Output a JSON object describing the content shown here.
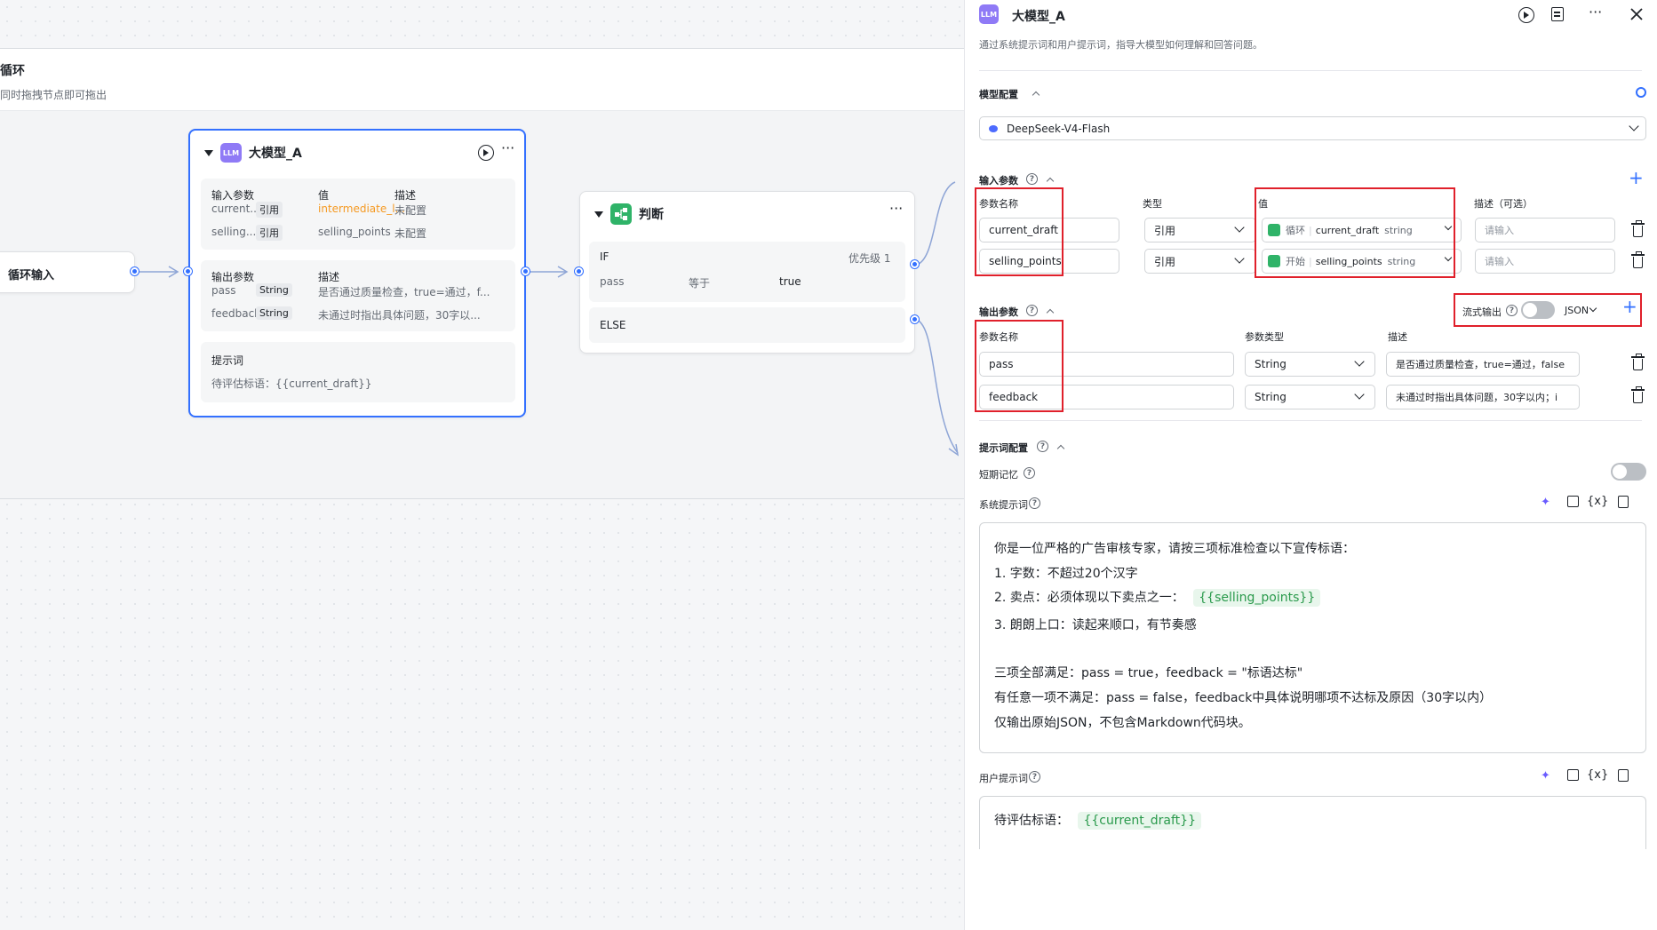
{
  "canvas": {
    "loop_title": "循环",
    "loop_hint": "同时拖拽节点即可拖出",
    "loop_input_node": "循环输入",
    "llm_node": {
      "title": "大模型_A",
      "inputs_header": {
        "name": "输入参数",
        "value": "值",
        "desc": "描述"
      },
      "inputs": [
        {
          "name": "current...",
          "type": "引用",
          "value": "intermediate_l...",
          "desc": "未配置"
        },
        {
          "name": "selling...",
          "type": "引用",
          "value": "selling_points",
          "desc": "未配置"
        }
      ],
      "outputs_header": {
        "name": "输出参数",
        "desc": "描述"
      },
      "outputs": [
        {
          "name": "pass",
          "type": "String",
          "desc": "是否通过质量检查，true=通过，f..."
        },
        {
          "name": "feedback",
          "type": "String",
          "desc": "未通过时指出具体问题，30字以..."
        }
      ],
      "prompt_label": "提示词",
      "prompt_text": "待评估标语：{{current_draft}}"
    },
    "condition_node": {
      "title": "判断",
      "if_label": "IF",
      "priority": "优先级 1",
      "cond_left": "pass",
      "cond_op": "等于",
      "cond_right": "true",
      "else_label": "ELSE"
    }
  },
  "panel": {
    "title": "大模型_A",
    "badge": "LLM",
    "description": "通过系统提示词和用户提示词，指导大模型如何理解和回答问题。",
    "model_section": "模型配置",
    "model_name": "DeepSeek-V4-Flash",
    "input_section": "输入参数",
    "input_cols": {
      "name": "参数名称",
      "type": "类型",
      "value": "值",
      "desc": "描述（可选）"
    },
    "inputs": [
      {
        "name": "current_draft",
        "type": "引用",
        "source": "循环",
        "var": "current_draft",
        "vtype": "string",
        "desc_placeholder": "请输入"
      },
      {
        "name": "selling_points",
        "type": "引用",
        "source": "开始",
        "var": "selling_points",
        "vtype": "string",
        "desc_placeholder": "请输入"
      }
    ],
    "output_section": "输出参数",
    "stream_label": "流式输出",
    "output_format": "JSON",
    "output_cols": {
      "name": "参数名称",
      "type": "参数类型",
      "desc": "描述"
    },
    "outputs": [
      {
        "name": "pass",
        "type": "String",
        "desc": "是否通过质量检查，true=通过，false"
      },
      {
        "name": "feedback",
        "type": "String",
        "desc": "未通过时指出具体问题，30字以内；i"
      }
    ],
    "prompt_section": "提示词配置",
    "short_memory": "短期记忆",
    "system_prompt_label": "系统提示词",
    "system_prompt": {
      "line1": "你是一位严格的广告审核专家，请按三项标准检查以下宣传标语：",
      "line2": "1. 字数：不超过20个汉字",
      "line3_prefix": "2. 卖点：必须体现以下卖点之一：",
      "line3_var": "{{selling_points}}",
      "line4": "3. 朗朗上口：读起来顺口，有节奏感",
      "line5": "三项全部满足：pass = true，feedback = \"标语达标\"",
      "line6": "有任意一项不满足：pass = false，feedback中具体说明哪项不达标及原因（30字以内）",
      "line7": "仅输出原始JSON，不包含Markdown代码块。"
    },
    "user_prompt_label": "用户提示词",
    "user_prompt_prefix": "待评估标语：",
    "user_prompt_var": "{{current_draft}}",
    "toolbar_icons": [
      "ai-sparkle-icon",
      "template-icon",
      "variable-icon",
      "save-icon"
    ],
    "var_icon_text": "{x}"
  }
}
